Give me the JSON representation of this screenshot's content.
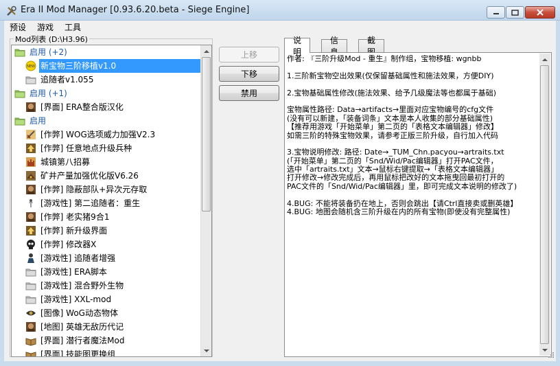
{
  "window": {
    "title": "Era II Mod Manager [0.93.6.20.beta - Siege Engine]"
  },
  "menu": [
    "预设",
    "游戏",
    "工具"
  ],
  "mod_list": {
    "label": "Mod列表 (D:\\H3.96)",
    "items": [
      {
        "type": "category",
        "text": "启用 (+2)",
        "icon": "folder-icon"
      },
      {
        "type": "mod",
        "text": "新宝物三阶移植v1.0",
        "icon": "new-badge-icon",
        "selected": true
      },
      {
        "type": "mod",
        "text": "追随者v1.055",
        "icon": "folder-gray-icon"
      },
      {
        "type": "category",
        "text": "启用 (+1)",
        "icon": "folder-icon"
      },
      {
        "type": "mod",
        "text": "[界面] ERA整合版汉化",
        "icon": "portrait-icon"
      },
      {
        "type": "category",
        "text": "启用",
        "icon": "folder-icon"
      },
      {
        "type": "mod",
        "text": "[作弊] WOG选项威力加强V2.3",
        "icon": "sword-icon"
      },
      {
        "type": "mod",
        "text": "[作弊] 任意地点升级兵种",
        "icon": "upgrade-icon"
      },
      {
        "type": "mod",
        "text": "城镇第八招募",
        "icon": "castle-icon"
      },
      {
        "type": "mod",
        "text": "矿井产量加强优化版V6.26",
        "icon": "mine-icon"
      },
      {
        "type": "mod",
        "text": "[作弊] 隐蔽部队+异次元存取",
        "icon": "portrait-icon"
      },
      {
        "type": "mod",
        "text": "[游戏性] 第二追随者：重生",
        "icon": "knight-icon"
      },
      {
        "type": "mod",
        "text": "[作弊] 老实猪9合1",
        "icon": "portrait-icon"
      },
      {
        "type": "mod",
        "text": "[作弊] 新升级界面",
        "icon": "upgrade-icon"
      },
      {
        "type": "mod",
        "text": "[作弊] 修改器X",
        "icon": "skull-icon"
      },
      {
        "type": "mod",
        "text": "[游戏性] 追随者增强",
        "icon": "hero-icon"
      },
      {
        "type": "mod",
        "text": "[游戏性] ERA脚本",
        "icon": "folder-gray-icon"
      },
      {
        "type": "mod",
        "text": "[游戏性] 混合野外生物",
        "icon": "folder-gray-icon"
      },
      {
        "type": "mod",
        "text": "[游戏性] XXL-mod",
        "icon": "folder-gray-icon"
      },
      {
        "type": "mod",
        "text": "[图像] WoG动态物体",
        "icon": "eye-icon"
      },
      {
        "type": "mod",
        "text": "[地图] 英雄无敌历代记",
        "icon": "portrait-icon"
      },
      {
        "type": "mod",
        "text": "[界面] 潜行者魔法Mod",
        "icon": "book-icon"
      },
      {
        "type": "mod",
        "text": "[界面] 技能图更换组",
        "icon": "book-icon"
      }
    ]
  },
  "buttons": {
    "up": "上移",
    "down": "下移",
    "disable": "禁用"
  },
  "tabs": [
    "说明",
    "信息",
    "截图"
  ],
  "description": [
    "作者: 『三阶升级Mod - 重生』制作组，宝物移植: wgnbb",
    "",
    "1.三阶新宝物空出效果(仅保留基础属性和施法效果，方便DIY)",
    "",
    "2.宝物基础属性修改(施法效果、给予几级魔法等也都属于基础)",
    "",
    "宝物属性路径: Data→artifacts→里面对应宝物编号的cfg文件",
    "(没有可以新建，「装备词条」文本是本人收集的部分基础属性)",
    "【推荐用游戏「开始菜单」第二页的「表格文本编辑器」修改】",
    "如需三阶的特殊宝物效果，请参考正版三阶升级，自行加入代码",
    "",
    "3.宝物说明修改: 路径: Date→_TUM_Chn.pacyou→artraits.txt",
    "(「开始菜单」第二页的「Snd/Wid/Pac编辑器」打开PAC文件，",
    "选中「artraits.txt」文本→鼠标右键提取→「表格文本编辑器」",
    "打开修改→修改完成后，再用鼠标把改好的文本拖曳回最初打开的",
    "PAC文件的「Snd/Wid/Pac编辑器」里，即可完成文本说明的修改了)",
    "",
    "4.BUG: 不能将装备扔在地上，否则会跳出【请Ctrl直接卖或删英雄】",
    "4.BUG: 地图会随机含三阶升级在内的所有宝物(即使没有完整属性)"
  ],
  "colors": {
    "selection": "#3399ff",
    "category_text": "#1f5aa8",
    "close_button": "#c7503d"
  }
}
